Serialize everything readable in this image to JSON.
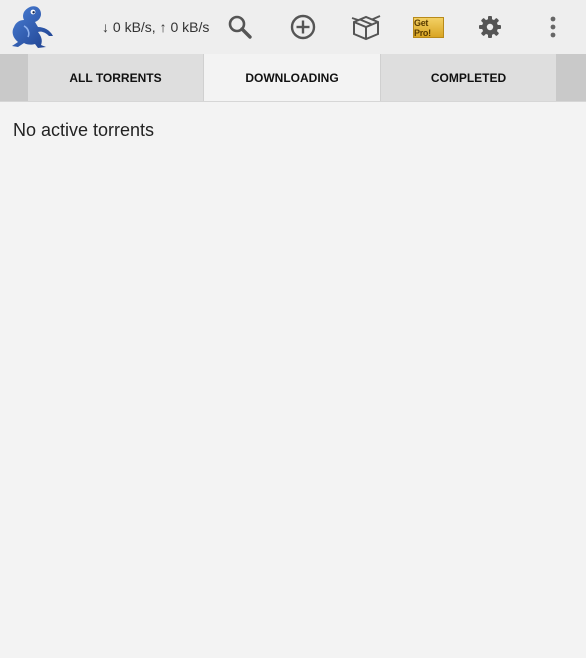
{
  "actionbar": {
    "speed_text": "↓ 0 kB/s, ↑ 0 kB/s",
    "get_pro_label": "Get Pro!",
    "icons": [
      "frog-logo-icon",
      "search-icon",
      "add-circle-icon",
      "package-icon",
      "settings-gear-icon",
      "overflow-menu-icon"
    ]
  },
  "tabs": [
    {
      "label": "ALL TORRENTS",
      "active": false
    },
    {
      "label": "DOWNLOADING",
      "active": true
    },
    {
      "label": "COMPLETED",
      "active": false
    }
  ],
  "main": {
    "empty_message": "No active torrents"
  },
  "colors": {
    "brand_blue": "#2f5fb8",
    "get_pro_gold": "#e1b336",
    "active_tab_bg": "#f3f3f3",
    "inactive_tab_bg": "#dedede"
  }
}
